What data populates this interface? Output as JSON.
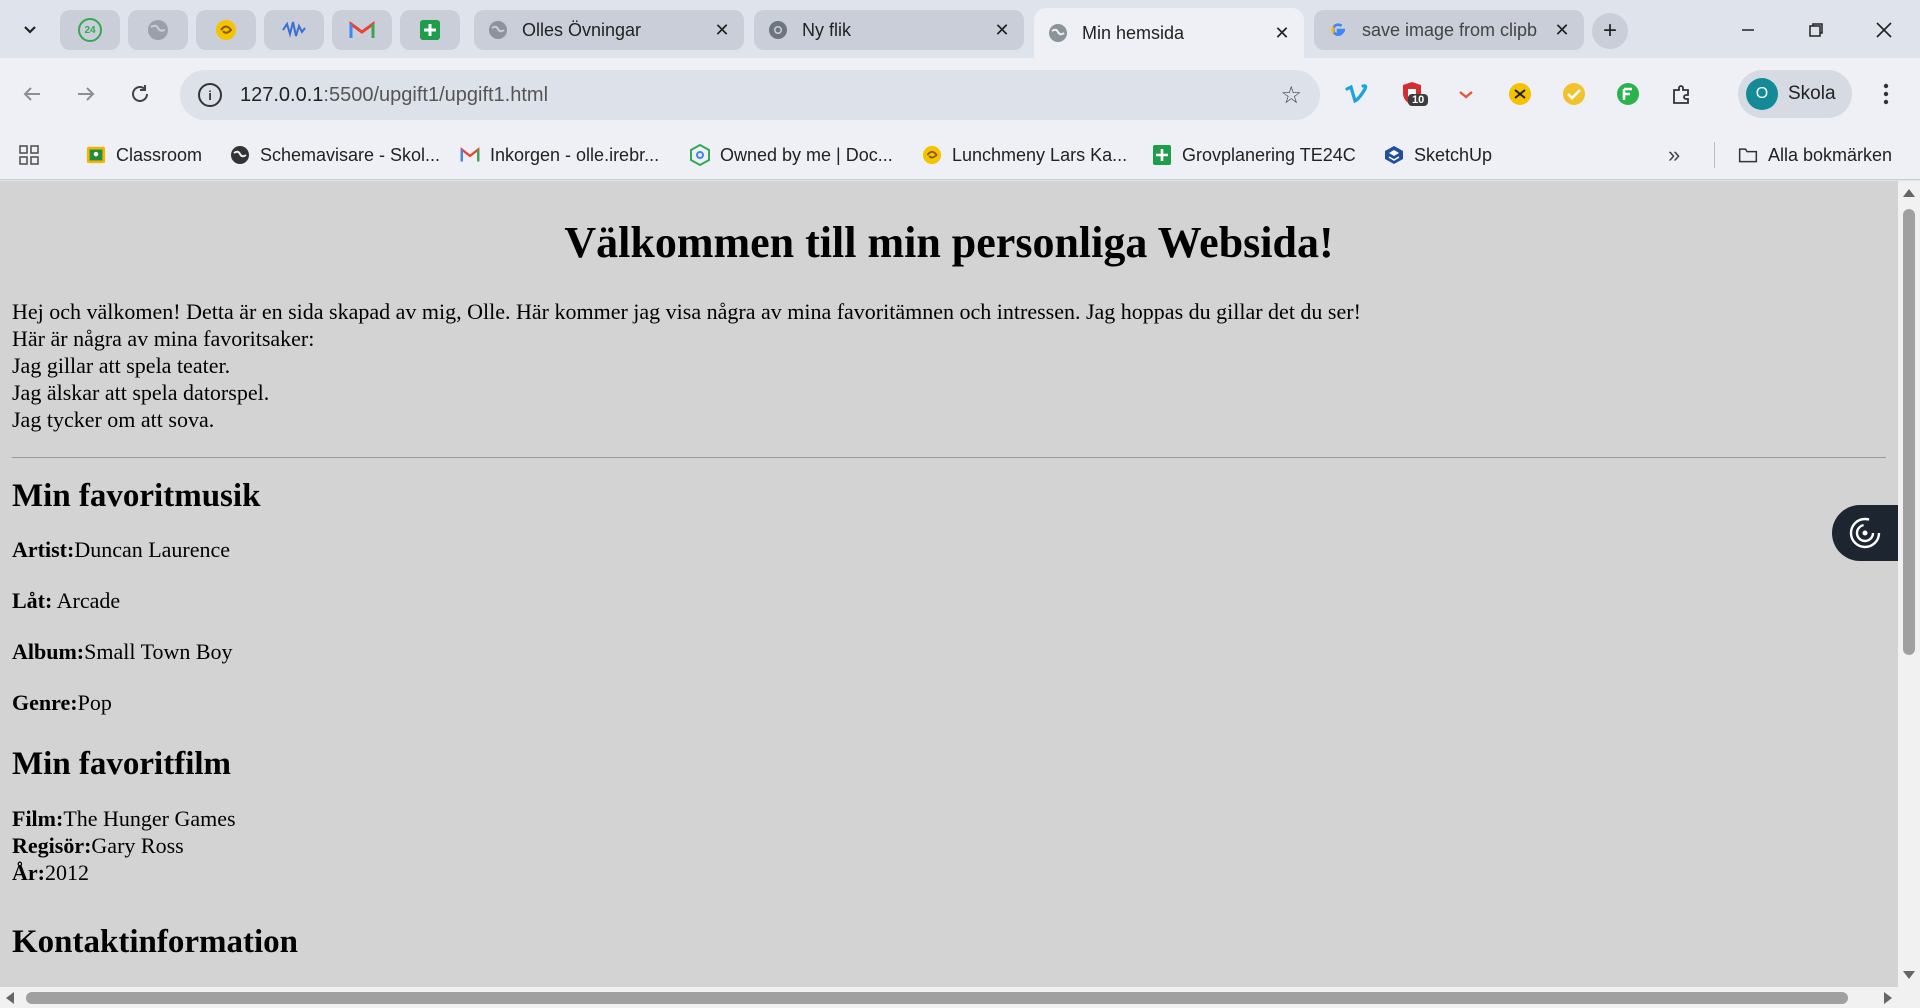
{
  "browser": {
    "tabs": [
      {
        "title": "Olles Övningar",
        "active": false
      },
      {
        "title": "Ny flik",
        "active": false
      },
      {
        "title": "Min hemsida",
        "active": true
      },
      {
        "title": "save image from clipb",
        "active": false
      }
    ],
    "pinned_badge": "24",
    "address": {
      "host": "127.0.0.1",
      "path": ":5500/upgift1/upgift1.html"
    },
    "extension_badge": "10",
    "profile": {
      "initial": "O",
      "name": "Skola"
    },
    "bookmarks": [
      {
        "label": "Classroom",
        "icon": "classroom-icon"
      },
      {
        "label": "Schemavisare - Skol...",
        "icon": "globe-icon"
      },
      {
        "label": "Inkorgen - olle.irebr...",
        "icon": "gmail-icon"
      },
      {
        "label": "Owned by me | Doc...",
        "icon": "docs-icon"
      },
      {
        "label": "Lunchmeny Lars Ka...",
        "icon": "lunch-icon"
      },
      {
        "label": "Grovplanering TE24C",
        "icon": "sheets-icon"
      },
      {
        "label": "SketchUp",
        "icon": "sketchup-icon"
      }
    ],
    "all_bookmarks": "Alla bokmärken",
    "colors": {
      "tabstrip": "#dfe3eb",
      "toolbar": "#eef0f5",
      "page_bg": "#d3d3d3"
    }
  },
  "page": {
    "heading": "Välkommen till min personliga Websida!",
    "intro": "Hej och välkomen! Detta är en sida skapad av mig, Olle. Här kommer jag visa några av mina favoritämnen och intressen. Jag hoppas du gillar det du ser!",
    "favorites_intro": "Här är några av mina favoritsaker:",
    "favorites": [
      "Jag gillar att spela teater.",
      "Jag älskar att spela datorspel.",
      "Jag tycker om att sova."
    ],
    "music": {
      "heading": "Min favoritmusik",
      "artist_label": "Artist:",
      "artist": "Duncan Laurence",
      "song_label": "Låt:",
      "song": " Arcade",
      "album_label": "Album:",
      "album": "Small Town Boy",
      "genre_label": "Genre:",
      "genre": "Pop"
    },
    "film": {
      "heading": "Min favoritfilm",
      "film_label": "Film:",
      "film": "The Hunger Games",
      "director_label": "Regisör:",
      "director": "Gary Ross",
      "year_label": "År:",
      "year": "2012"
    },
    "contact_heading": "Kontaktinformation"
  }
}
